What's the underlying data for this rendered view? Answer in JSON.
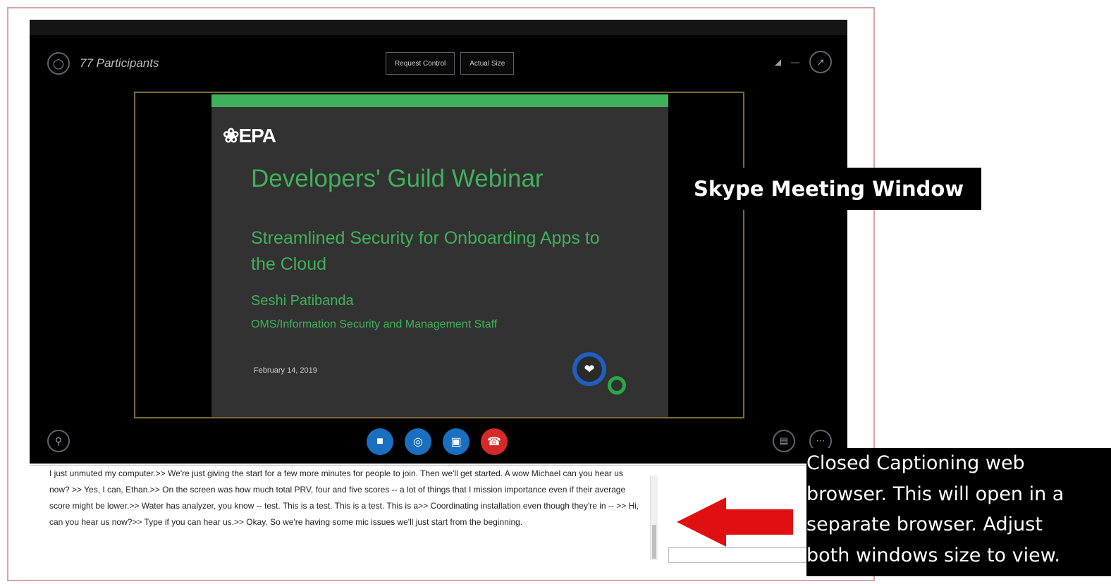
{
  "meeting": {
    "participants_label": "77 Participants",
    "request_control_label": "Request Control",
    "actual_size_label": "Actual Size"
  },
  "slide": {
    "logo_text": "EPA",
    "title": "Developers' Guild Webinar",
    "subtitle": "Streamlined Security for Onboarding Apps to the Cloud",
    "presenter": "Seshi Patibanda",
    "organization": "OMS/Information Security and Management Staff",
    "date": "February 14, 2019"
  },
  "captions": {
    "text": "I just unmuted my computer.>> We're just giving the start for a few more minutes for people to join. Then we'll get started. A wow Michael can you hear us now? >> Yes, I can, Ethan.>> On the screen was how much total PRV, four and five scores -- a lot of things that I mission importance even if their average score might be lower.>> Water has analyzer, you know -- test. This is a test. This is a test. This is a>> Coordinating installation even though they're in -- >> Hi, can you hear us now?>> Type if you can hear us.>> Okay. So we're having some mic issues we'll just start from the beginning."
  },
  "annotations": {
    "skype_label": "Skype Meeting Window",
    "cc_lines": [
      "Closed Captioning web",
      "browser. This will open in a",
      "separate browser. Adjust",
      "both windows size to view."
    ]
  },
  "colors": {
    "slide_green": "#3fb15a",
    "end_call_red": "#d62a2a",
    "call_blue": "#1a6fc0",
    "arrow_red": "#e01010"
  },
  "icons": {
    "chat": "chat-icon",
    "signal": "signal-icon",
    "popout": "popout-icon",
    "video": "video-icon",
    "mic": "mic-icon",
    "present": "present-icon",
    "end_call": "end-call-icon",
    "devices": "devices-icon",
    "more": "more-icon"
  }
}
